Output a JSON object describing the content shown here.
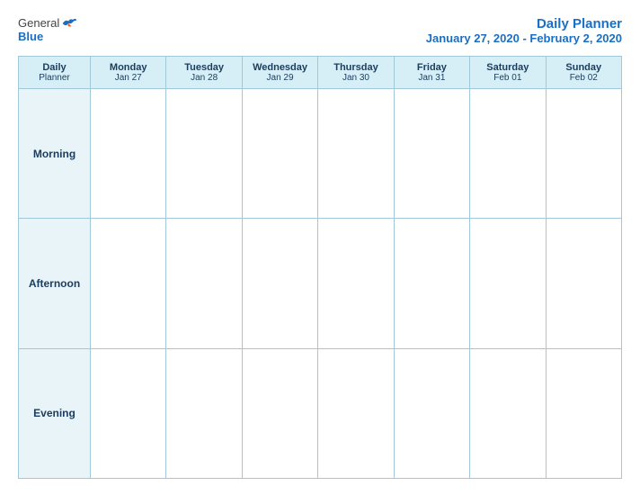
{
  "logo": {
    "general": "General",
    "blue": "Blue"
  },
  "title": {
    "main": "Daily Planner",
    "date_range": "January 27, 2020 - February 2, 2020"
  },
  "table": {
    "header": [
      {
        "id": "col-planner",
        "label": "Daily",
        "sub": "Planner"
      },
      {
        "id": "col-mon",
        "label": "Monday",
        "sub": "Jan 27"
      },
      {
        "id": "col-tue",
        "label": "Tuesday",
        "sub": "Jan 28"
      },
      {
        "id": "col-wed",
        "label": "Wednesday",
        "sub": "Jan 29"
      },
      {
        "id": "col-thu",
        "label": "Thursday",
        "sub": "Jan 30"
      },
      {
        "id": "col-fri",
        "label": "Friday",
        "sub": "Jan 31"
      },
      {
        "id": "col-sat",
        "label": "Saturday",
        "sub": "Feb 01"
      },
      {
        "id": "col-sun",
        "label": "Sunday",
        "sub": "Feb 02"
      }
    ],
    "rows": [
      {
        "id": "row-morning",
        "label": "Morning"
      },
      {
        "id": "row-afternoon",
        "label": "Afternoon"
      },
      {
        "id": "row-evening",
        "label": "Evening"
      }
    ]
  }
}
